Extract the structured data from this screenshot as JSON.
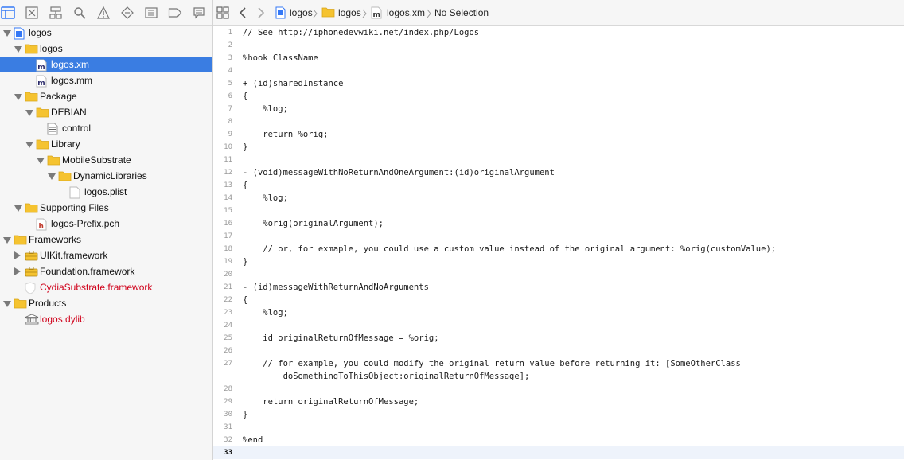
{
  "navigator": {
    "tree": [
      {
        "label": "logos",
        "depth": 0,
        "expand": "down",
        "icon": "project-icon",
        "kind": "project"
      },
      {
        "label": "logos",
        "depth": 1,
        "expand": "down",
        "icon": "folder-icon",
        "kind": "group"
      },
      {
        "label": "logos.xm",
        "depth": 2,
        "expand": "",
        "icon": "m-file-icon",
        "kind": "file",
        "selected": true
      },
      {
        "label": "logos.mm",
        "depth": 2,
        "expand": "",
        "icon": "m-file-icon",
        "kind": "file"
      },
      {
        "label": "Package",
        "depth": 1,
        "expand": "down",
        "icon": "folder-icon",
        "kind": "group"
      },
      {
        "label": "DEBIAN",
        "depth": 2,
        "expand": "down",
        "icon": "folder-icon",
        "kind": "group"
      },
      {
        "label": "control",
        "depth": 3,
        "expand": "",
        "icon": "text-file-icon",
        "kind": "file"
      },
      {
        "label": "Library",
        "depth": 2,
        "expand": "down",
        "icon": "folder-icon",
        "kind": "group"
      },
      {
        "label": "MobileSubstrate",
        "depth": 3,
        "expand": "down",
        "icon": "folder-icon",
        "kind": "group"
      },
      {
        "label": "DynamicLibraries",
        "depth": 4,
        "expand": "down",
        "icon": "folder-icon",
        "kind": "group"
      },
      {
        "label": "logos.plist",
        "depth": 5,
        "expand": "",
        "icon": "plist-file-icon",
        "kind": "file"
      },
      {
        "label": "Supporting Files",
        "depth": 1,
        "expand": "down",
        "icon": "folder-icon",
        "kind": "group"
      },
      {
        "label": "logos-Prefix.pch",
        "depth": 2,
        "expand": "",
        "icon": "h-file-icon",
        "kind": "file"
      },
      {
        "label": "Frameworks",
        "depth": 0,
        "expand": "down",
        "icon": "folder-icon",
        "kind": "group"
      },
      {
        "label": "UIKit.framework",
        "depth": 1,
        "expand": "right",
        "icon": "toolbox-icon",
        "kind": "framework"
      },
      {
        "label": "Foundation.framework",
        "depth": 1,
        "expand": "right",
        "icon": "toolbox-icon",
        "kind": "framework"
      },
      {
        "label": "CydiaSubstrate.framework",
        "depth": 1,
        "expand": "",
        "icon": "shield-icon",
        "kind": "missing"
      },
      {
        "label": "Products",
        "depth": 0,
        "expand": "down",
        "icon": "folder-icon",
        "kind": "group"
      },
      {
        "label": "logos.dylib",
        "depth": 1,
        "expand": "",
        "icon": "library-icon",
        "kind": "missing"
      }
    ]
  },
  "jumpbar": {
    "project": "logos",
    "group": "logos",
    "file": "logos.xm",
    "selection": "No Selection"
  },
  "editor": {
    "current_line": 33,
    "lines": [
      {
        "n": "1",
        "text": "// See http://iphonedevwiki.net/index.php/Logos"
      },
      {
        "n": "2",
        "text": ""
      },
      {
        "n": "3",
        "text": "%hook ClassName"
      },
      {
        "n": "4",
        "text": ""
      },
      {
        "n": "5",
        "text": "+ (id)sharedInstance"
      },
      {
        "n": "6",
        "text": "{"
      },
      {
        "n": "7",
        "text": "    %log;"
      },
      {
        "n": "8",
        "text": ""
      },
      {
        "n": "9",
        "text": "    return %orig;"
      },
      {
        "n": "10",
        "text": "}"
      },
      {
        "n": "11",
        "text": ""
      },
      {
        "n": "12",
        "text": "- (void)messageWithNoReturnAndOneArgument:(id)originalArgument"
      },
      {
        "n": "13",
        "text": "{"
      },
      {
        "n": "14",
        "text": "    %log;"
      },
      {
        "n": "15",
        "text": ""
      },
      {
        "n": "16",
        "text": "    %orig(originalArgument);"
      },
      {
        "n": "17",
        "text": ""
      },
      {
        "n": "18",
        "text": "    // or, for exmaple, you could use a custom value instead of the original argument: %orig(customValue);"
      },
      {
        "n": "19",
        "text": "}"
      },
      {
        "n": "20",
        "text": ""
      },
      {
        "n": "21",
        "text": "- (id)messageWithReturnAndNoArguments"
      },
      {
        "n": "22",
        "text": "{"
      },
      {
        "n": "23",
        "text": "    %log;"
      },
      {
        "n": "24",
        "text": ""
      },
      {
        "n": "25",
        "text": "    id originalReturnOfMessage = %orig;"
      },
      {
        "n": "26",
        "text": ""
      },
      {
        "n": "27",
        "text": "    // for example, you could modify the original return value before returning it: [SomeOtherClass"
      },
      {
        "n": "",
        "text": "        doSomethingToThisObject:originalReturnOfMessage];"
      },
      {
        "n": "28",
        "text": ""
      },
      {
        "n": "29",
        "text": "    return originalReturnOfMessage;"
      },
      {
        "n": "30",
        "text": "}"
      },
      {
        "n": "31",
        "text": ""
      },
      {
        "n": "32",
        "text": "%end"
      },
      {
        "n": "33",
        "text": ""
      }
    ]
  },
  "colors": {
    "selection": "#3a7de2",
    "missing_file": "#d0021b",
    "folder": "#f5c330",
    "accent": "#3478f6"
  }
}
